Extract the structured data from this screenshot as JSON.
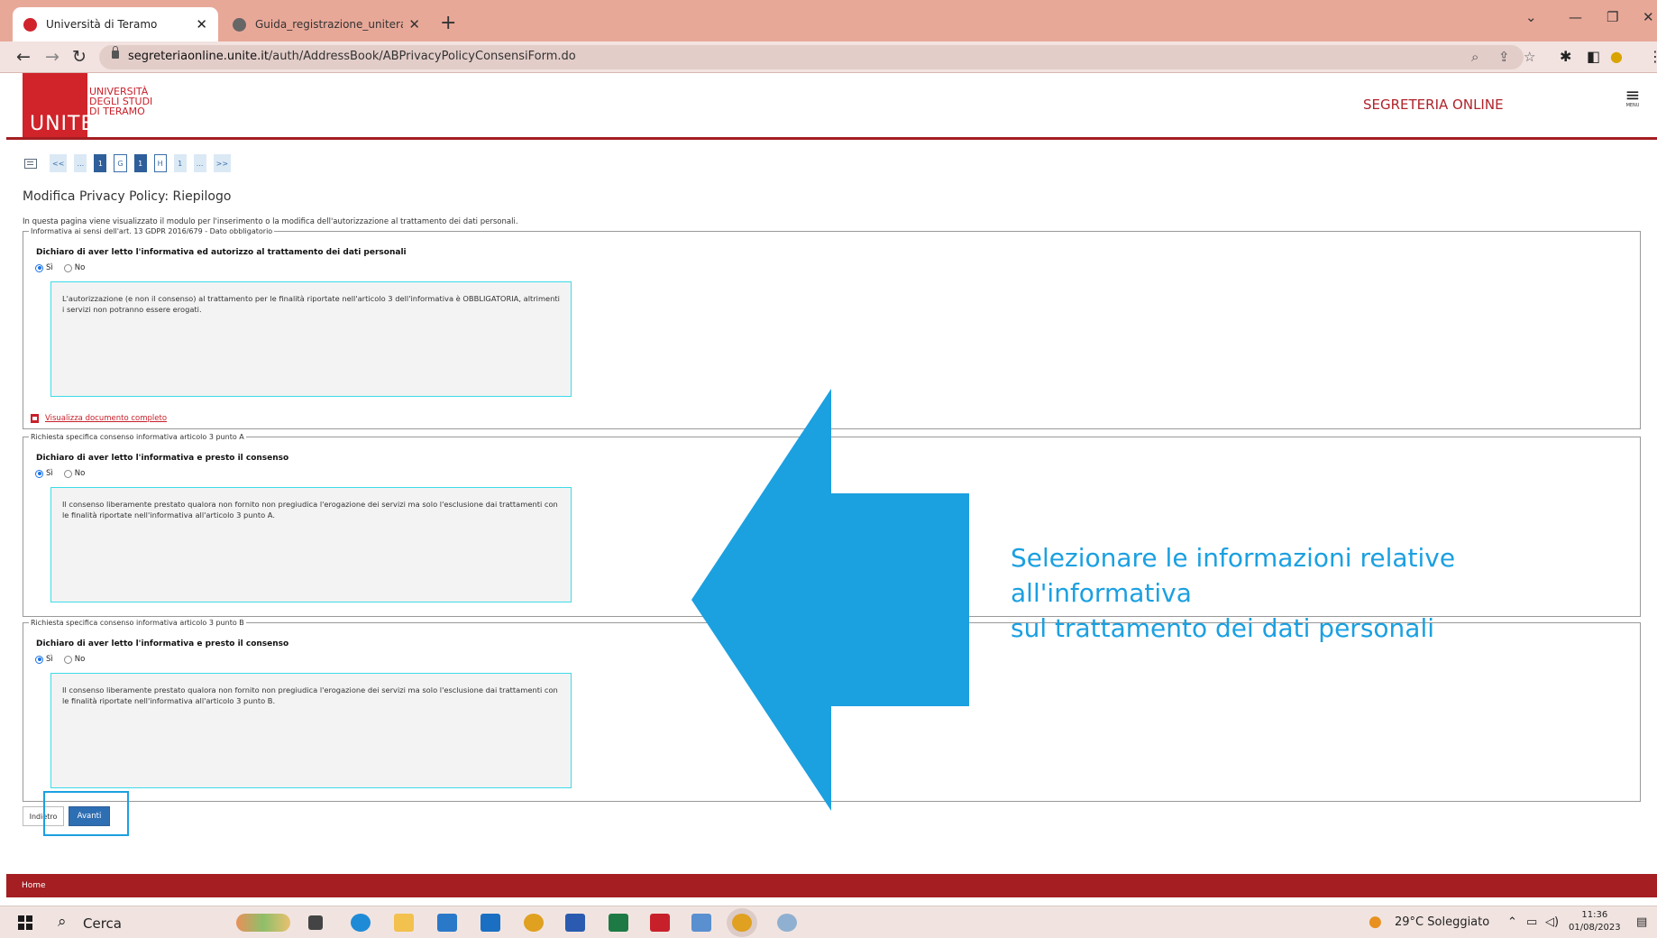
{
  "browser": {
    "tabs": [
      {
        "title": "Università di Teramo",
        "active": true
      },
      {
        "title": "Guida_registrazione_uniteramo.p",
        "active": false
      }
    ],
    "url_host": "segreteriaonline.unite.it",
    "url_path": "/auth/AddressBook/ABPrivacyPolicyConsensiForm.do"
  },
  "header": {
    "logo_main": "UNITE",
    "logo_line1": "UNIVERSITÀ",
    "logo_line2": "DEGLI STUDI",
    "logo_line3": "DI TERAMO",
    "portal_title": "SEGRETERIA ONLINE",
    "menu_label": "MENU"
  },
  "steps": [
    "<<",
    "...",
    "1",
    "G",
    "1",
    "H",
    "1",
    "...",
    ">>"
  ],
  "main": {
    "title": "Modifica Privacy Policy: Riepilogo",
    "description": "In questa pagina viene visualizzato il modulo per l'inserimento o la modifica dell'autorizzazione al trattamento dei dati personali."
  },
  "sections": [
    {
      "legend": "Informativa ai sensi dell'art. 13 GDPR 2016/679 - Dato obbligatorio",
      "question": "Dichiaro di aver letto l'informativa ed autorizzo al trattamento dei dati personali",
      "yes_label": "Sì",
      "no_label": "No",
      "selected": "yes",
      "text": "L'autorizzazione (e non il consenso) al trattamento per le finalità riportate nell'articolo 3 dell'informativa è OBBLIGATORIA, altrimenti i servizi non potranno essere erogati.",
      "link": "Visualizza documento completo"
    },
    {
      "legend": "Richiesta specifica consenso informativa articolo 3 punto A",
      "question": "Dichiaro di aver letto l'informativa e presto il consenso",
      "yes_label": "Sì",
      "no_label": "No",
      "selected": "yes",
      "text": "Il consenso liberamente prestato qualora non fornito non pregiudica l'erogazione dei servizi ma solo l'esclusione dai trattamenti con le finalità riportate nell'informativa all'articolo 3 punto A."
    },
    {
      "legend": "Richiesta specifica consenso informativa articolo 3 punto B",
      "question": "Dichiaro di aver letto l'informativa e presto il consenso",
      "yes_label": "Sì",
      "no_label": "No",
      "selected": "yes",
      "text": "Il consenso liberamente prestato qualora non fornito non pregiudica l'erogazione dei servizi ma solo l'esclusione dai trattamenti con le finalità riportate nell'informativa all'articolo 3 punto B."
    }
  ],
  "buttons": {
    "back": "Indietro",
    "next": "Avanti"
  },
  "footer": {
    "home": "Home"
  },
  "annotation": {
    "line1": "Selezionare le informazioni relative all'informativa",
    "line2": "sul trattamento dei dati personali",
    "color": "#1ba0e0"
  },
  "taskbar": {
    "search": "Cerca",
    "weather": "29°C  Soleggiato",
    "time": "11:36",
    "date": "01/08/2023"
  },
  "colors": {
    "brand_red": "#a41e22",
    "primary_blue": "#2e6eb3",
    "tabbar": "#e8a898"
  }
}
